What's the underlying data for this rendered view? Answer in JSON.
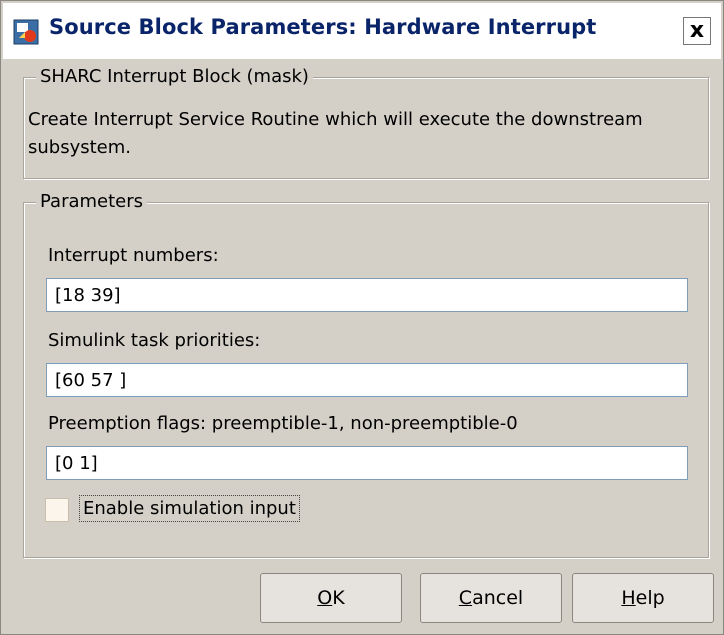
{
  "window": {
    "title": "Source Block Parameters: Hardware Interrupt",
    "close_label": "x"
  },
  "mask_group": {
    "legend": "SHARC Interrupt Block (mask)",
    "description": "Create Interrupt Service Routine which will execute the downstream subsystem."
  },
  "params_group": {
    "legend": "Parameters",
    "fields": [
      {
        "label": "Interrupt numbers:",
        "value": "[18 39]"
      },
      {
        "label": "Simulink task priorities:",
        "value": "[60 57 ]"
      },
      {
        "label": "Preemption flags: preemptible-1, non-preemptible-0",
        "value": "[0 1]"
      }
    ],
    "checkbox": {
      "label": "Enable simulation input",
      "checked": false
    }
  },
  "buttons": {
    "ok": {
      "mnemonic": "O",
      "rest": "K"
    },
    "cancel": {
      "mnemonic": "C",
      "rest": "ancel"
    },
    "help": {
      "mnemonic": "H",
      "rest": "elp"
    }
  },
  "colors": {
    "dialog_bg": "#d4d0c8",
    "title_text": "#0a246a",
    "field_border": "#7f9db9"
  },
  "icons": {
    "app": "simulink-block-icon",
    "close": "close-icon"
  }
}
